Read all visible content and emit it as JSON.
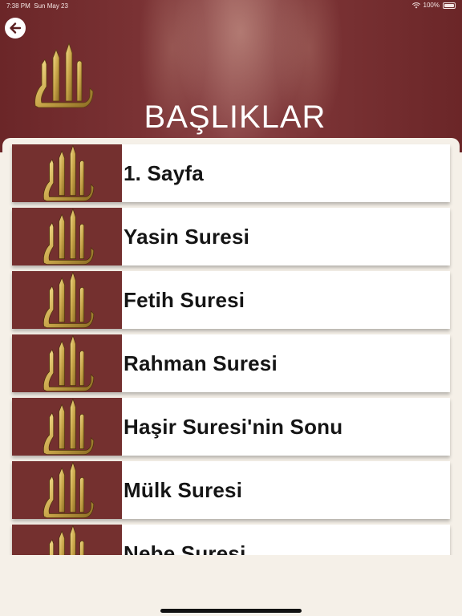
{
  "status_bar": {
    "time": "7:38 PM",
    "date": "Sun May 23",
    "battery": "100%"
  },
  "header": {
    "title": "BAŞLIKLAR",
    "back_icon": "arrow-left-icon"
  },
  "colors": {
    "header_maroon": "#7a3234",
    "thumb_maroon": "#74302f",
    "gold": "#c9a64a",
    "background": "#f5f0e8"
  },
  "items": [
    {
      "label": "1. Sayfa"
    },
    {
      "label": "Yasin Suresi"
    },
    {
      "label": "Fetih Suresi"
    },
    {
      "label": "Rahman Suresi"
    },
    {
      "label": "Haşir Suresi'nin Sonu"
    },
    {
      "label": "Mülk Suresi"
    },
    {
      "label": "Nebe Suresi"
    }
  ]
}
